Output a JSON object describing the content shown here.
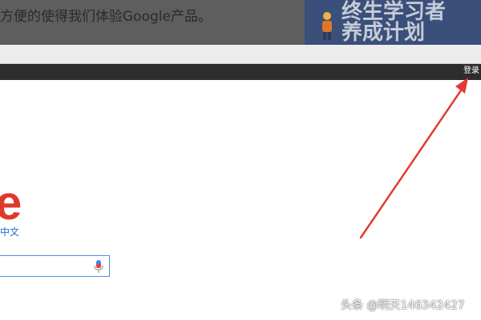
{
  "article": {
    "text": "方便的使得我们体验Google产品。"
  },
  "promo": {
    "line1": "终生学习者",
    "line2": "养成计划"
  },
  "google_bar": {
    "login_label": "登录"
  },
  "logo": {
    "visible_letter": "e",
    "region_label": "中文"
  },
  "search": {
    "value": ""
  },
  "watermark": {
    "text": "头条 @明天146342427"
  },
  "colors": {
    "google_bar_bg": "#2d2d2d",
    "logo_red": "#e0382b",
    "region_blue": "#2a6fd6",
    "search_border": "#4a90e2",
    "arrow_red": "#e53935"
  },
  "icons": {
    "mic": "microphone-icon",
    "arrow": "annotation-arrow"
  }
}
